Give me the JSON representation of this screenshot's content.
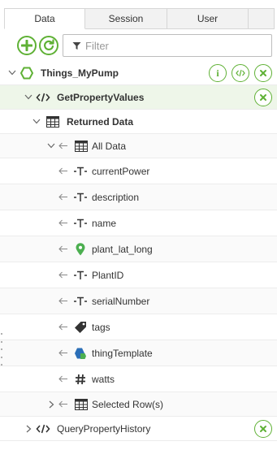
{
  "tabs": [
    {
      "label": "Data",
      "active": true
    },
    {
      "label": "Session",
      "active": false
    },
    {
      "label": "User",
      "active": false
    }
  ],
  "toolbar": {
    "add_icon": "plus-circle-icon",
    "refresh_icon": "refresh-icon",
    "filter_placeholder": "Filter",
    "filter_value": "",
    "filter_icon": "funnel-icon"
  },
  "colors": {
    "accent": "#5fb135",
    "selected_row": "#eef6e9",
    "pin": "#4caf50",
    "thing_template_blue": "#2b6fb7"
  },
  "tree": {
    "thing": {
      "label": "Things_MyPump",
      "expanded": true,
      "actions": [
        "info-icon",
        "code-icon",
        "close-icon"
      ]
    },
    "service": {
      "label": "GetPropertyValues",
      "expanded": true,
      "selected": true,
      "actions": [
        "close-icon"
      ]
    },
    "returned_data": {
      "label": "Returned Data",
      "expanded": true
    },
    "all_data": {
      "label": "All Data",
      "expanded": true
    },
    "fields": [
      {
        "label": "currentPower",
        "icon": "string-type-icon"
      },
      {
        "label": "description",
        "icon": "string-type-icon"
      },
      {
        "label": "name",
        "icon": "string-type-icon"
      },
      {
        "label": "plant_lat_long",
        "icon": "location-pin-icon"
      },
      {
        "label": "PlantID",
        "icon": "string-type-icon"
      },
      {
        "label": "serialNumber",
        "icon": "string-type-icon"
      },
      {
        "label": "tags",
        "icon": "tag-icon"
      },
      {
        "label": "thingTemplate",
        "icon": "thing-template-icon"
      },
      {
        "label": "watts",
        "icon": "number-type-icon"
      }
    ],
    "selected_rows": {
      "label": "Selected Row(s)",
      "expanded": false
    },
    "query_service": {
      "label": "QueryPropertyHistory",
      "expanded": false,
      "actions": [
        "close-icon"
      ]
    }
  }
}
